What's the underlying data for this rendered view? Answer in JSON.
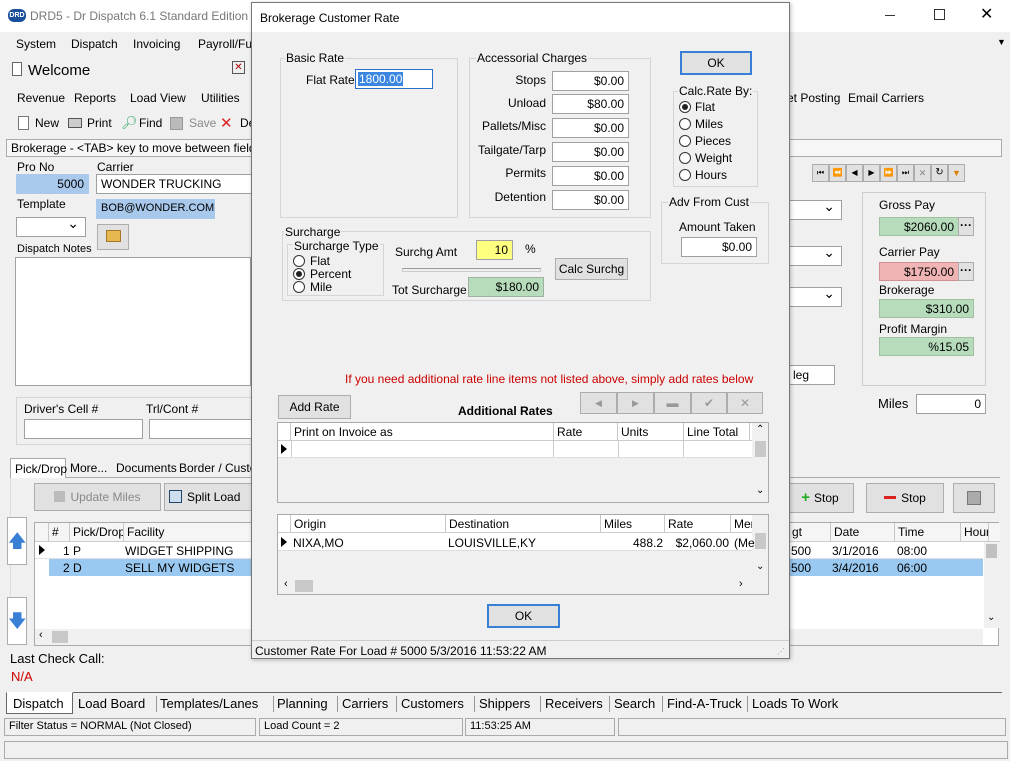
{
  "app": {
    "title": "DRD5 - Dr Dispatch 6.1 Standard Edition - ...",
    "logo": "DRD"
  },
  "menu": [
    "System",
    "Dispatch",
    "Invoicing",
    "Payroll/Fu"
  ],
  "welcome": {
    "title": "Welcome"
  },
  "toolbar1": [
    "Revenue",
    "Reports",
    "Load View",
    "Utilities"
  ],
  "toolbar1_right": [
    "et Posting",
    "Email Carriers"
  ],
  "toolbar2": {
    "new": "New",
    "print": "Print",
    "find": "Find",
    "save": "Save",
    "delete": "De"
  },
  "hint": "Brokerage - <TAB> key to move between fields",
  "load": {
    "pro_label": "Pro No",
    "pro": "5000",
    "carrier_label": "Carrier",
    "carrier": "WONDER TRUCKING",
    "template_label": "Template",
    "email": "BOB@WONDER.COM",
    "notes_label": "Dispatch Notes",
    "driver_cell_label": "Driver's Cell #",
    "trl_label": "Trl/Cont #",
    "leg": "leg"
  },
  "summary": {
    "gross_label": "Gross Pay",
    "gross": "$2060.00",
    "carrier_label": "Carrier Pay",
    "carrier": "$1750.00",
    "brokerage_label": "Brokerage",
    "brokerage": "$310.00",
    "margin_label": "Profit Margin",
    "margin": "%15.05",
    "miles_label": "Miles",
    "miles": "0"
  },
  "tabs": [
    "Pick/Drop",
    "More...",
    "Documents",
    "Border / Custo"
  ],
  "actions": {
    "update_miles": "Update Miles",
    "split_load": "Split Load",
    "add_stop": "Stop",
    "remove_stop": "Stop"
  },
  "stops": {
    "headers": [
      "#",
      "Pick/Drop",
      "Facility"
    ],
    "headers_right": [
      "gt",
      "Date",
      "Time",
      "Hour"
    ],
    "rows": [
      {
        "n": "1",
        "pd": "P",
        "facility": "WIDGET SHIPPING",
        "wgt": "500",
        "date": "3/1/2016",
        "time": "08:00"
      },
      {
        "n": "2",
        "pd": "D",
        "facility": "SELL MY WIDGETS",
        "wgt": "500",
        "date": "3/4/2016",
        "time": "06:00"
      }
    ]
  },
  "last_check": {
    "label": "Last Check Call:",
    "value": "N/A"
  },
  "bottom_tabs": [
    "Dispatch",
    "Load Board",
    "Templates/Lanes",
    "Planning",
    "Carriers",
    "Customers",
    "Shippers",
    "Receivers",
    "Search",
    "Find-A-Truck",
    "Loads To Work"
  ],
  "status": {
    "filter": "Filter Status = NORMAL (Not Closed)",
    "count": "Load Count = 2",
    "time": "11:53:25 AM"
  },
  "dialog": {
    "title": "Brokerage Customer Rate",
    "basic_rate": {
      "legend": "Basic Rate",
      "flat_label": "Flat Rate",
      "flat": "1800.00"
    },
    "accessorial": {
      "legend": "Accessorial Charges",
      "items": [
        {
          "label": "Stops",
          "value": "$0.00"
        },
        {
          "label": "Unload",
          "value": "$80.00"
        },
        {
          "label": "Pallets/Misc",
          "value": "$0.00"
        },
        {
          "label": "Tailgate/Tarp",
          "value": "$0.00"
        },
        {
          "label": "Permits",
          "value": "$0.00"
        },
        {
          "label": "Detention",
          "value": "$0.00"
        }
      ]
    },
    "ok_top": "OK",
    "calc_by": {
      "legend": "Calc.Rate By:",
      "options": [
        "Flat",
        "Miles",
        "Pieces",
        "Weight",
        "Hours"
      ],
      "selected": "Flat"
    },
    "adv": {
      "legend": "Adv From Cust",
      "amount_label": "Amount Taken",
      "amount": "$0.00"
    },
    "surcharge": {
      "legend": "Surcharge",
      "type_legend": "Surcharge Type",
      "types": [
        "Flat",
        "Percent",
        "Mile"
      ],
      "selected": "Percent",
      "amt_label": "Surchg Amt",
      "amt": "10",
      "pct": "%",
      "calc_btn": "Calc Surchg",
      "tot_label": "Tot Surcharge",
      "tot": "$180.00"
    },
    "notice": "If you need additional rate line items not listed above, simply add rates below",
    "add_rate": "Add Rate",
    "additional_title": "Additional Rates",
    "add_headers": [
      "Print on Invoice as",
      "Rate",
      "Units",
      "Line Total"
    ],
    "route_headers": [
      "Origin",
      "Destination",
      "Miles",
      "Rate",
      "Mer"
    ],
    "route_row": {
      "origin": "NIXA,MO",
      "dest": "LOUISVILLE,KY",
      "miles": "488.2",
      "rate": "$2,060.00",
      "mer": "(Me"
    },
    "ok_bottom": "OK",
    "status": "Customer Rate For Load # 5000",
    "status_time": "5/3/2016 11:53:22 AM"
  },
  "colors": {
    "blue_field": "#a8c8ec",
    "green_field": "#b7dcbb",
    "red_field": "#f0b4b4",
    "yellow_field": "#ffff80",
    "notice_red": "#cc0000",
    "row_select": "#99c8f0"
  }
}
